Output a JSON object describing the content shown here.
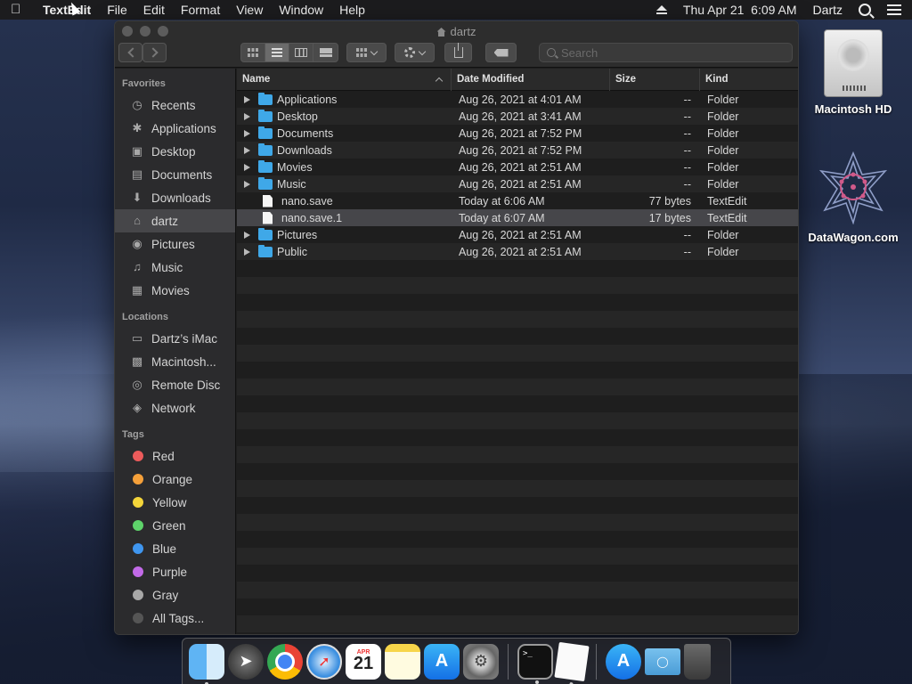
{
  "menubar": {
    "app_name": "TextEdit",
    "items": [
      "File",
      "Edit",
      "Format",
      "View",
      "Window",
      "Help"
    ],
    "datetime": "Thu Apr 21  6:09 AM",
    "user": "Dartz"
  },
  "window": {
    "title": "dartz",
    "search_placeholder": "Search"
  },
  "sidebar": {
    "favorites_heading": "Favorites",
    "favorites": [
      {
        "label": "Recents",
        "icon": "clock-icon"
      },
      {
        "label": "Applications",
        "icon": "applications-icon"
      },
      {
        "label": "Desktop",
        "icon": "desktop-icon"
      },
      {
        "label": "Documents",
        "icon": "documents-icon"
      },
      {
        "label": "Downloads",
        "icon": "downloads-icon"
      },
      {
        "label": "dartz",
        "icon": "home-icon"
      },
      {
        "label": "Pictures",
        "icon": "camera-icon"
      },
      {
        "label": "Music",
        "icon": "music-note-icon"
      },
      {
        "label": "Movies",
        "icon": "film-icon"
      }
    ],
    "locations_heading": "Locations",
    "locations": [
      {
        "label": "Dartz’s iMac",
        "icon": "imac-icon"
      },
      {
        "label": "Macintosh...",
        "icon": "hard-drive-icon"
      },
      {
        "label": "Remote Disc",
        "icon": "disc-icon"
      },
      {
        "label": "Network",
        "icon": "globe-icon"
      }
    ],
    "tags_heading": "Tags",
    "tags": [
      {
        "label": "Red",
        "color": "#ec5b5b"
      },
      {
        "label": "Orange",
        "color": "#f5a03a"
      },
      {
        "label": "Yellow",
        "color": "#f4d53a"
      },
      {
        "label": "Green",
        "color": "#5ed36a"
      },
      {
        "label": "Blue",
        "color": "#3f96ef"
      },
      {
        "label": "Purple",
        "color": "#c26ae8"
      },
      {
        "label": "Gray",
        "color": "#a8a8a8"
      },
      {
        "label": "All Tags...",
        "color": "#555555"
      }
    ]
  },
  "columns": {
    "name": "Name",
    "date": "Date Modified",
    "size": "Size",
    "kind": "Kind"
  },
  "files": [
    {
      "name": "Applications",
      "date": "Aug 26, 2021 at 4:01 AM",
      "size": "--",
      "kind": "Folder",
      "type": "folder"
    },
    {
      "name": "Desktop",
      "date": "Aug 26, 2021 at 3:41 AM",
      "size": "--",
      "kind": "Folder",
      "type": "folder"
    },
    {
      "name": "Documents",
      "date": "Aug 26, 2021 at 7:52 PM",
      "size": "--",
      "kind": "Folder",
      "type": "folder"
    },
    {
      "name": "Downloads",
      "date": "Aug 26, 2021 at 7:52 PM",
      "size": "--",
      "kind": "Folder",
      "type": "folder"
    },
    {
      "name": "Movies",
      "date": "Aug 26, 2021 at 2:51 AM",
      "size": "--",
      "kind": "Folder",
      "type": "folder"
    },
    {
      "name": "Music",
      "date": "Aug 26, 2021 at 2:51 AM",
      "size": "--",
      "kind": "Folder",
      "type": "folder"
    },
    {
      "name": "nano.save",
      "date": "Today at 6:06 AM",
      "size": "77 bytes",
      "kind": "TextEdit",
      "type": "file"
    },
    {
      "name": "nano.save.1",
      "date": "Today at 6:07 AM",
      "size": "17 bytes",
      "kind": "TextEdit",
      "type": "file",
      "selected": true
    },
    {
      "name": "Pictures",
      "date": "Aug 26, 2021 at 2:51 AM",
      "size": "--",
      "kind": "Folder",
      "type": "folder"
    },
    {
      "name": "Public",
      "date": "Aug 26, 2021 at 2:51 AM",
      "size": "--",
      "kind": "Folder",
      "type": "folder"
    }
  ],
  "desktop": {
    "items": [
      {
        "label": "Macintosh HD",
        "icon": "hard-drive-icon"
      },
      {
        "label": "DataWagon.com",
        "icon": "star-logo-icon"
      }
    ]
  },
  "dock": {
    "apps": [
      {
        "name": "finder",
        "icon": "finder-icon",
        "running": true
      },
      {
        "name": "launchpad",
        "icon": "rocket-icon",
        "running": false
      },
      {
        "name": "chrome",
        "icon": "chrome-icon",
        "running": false
      },
      {
        "name": "safari",
        "icon": "compass-icon",
        "running": false
      },
      {
        "name": "calendar",
        "icon": "calendar-icon",
        "running": false,
        "month": "APR",
        "day": "21"
      },
      {
        "name": "notes",
        "icon": "notes-icon",
        "running": false
      },
      {
        "name": "app-store",
        "icon": "app-store-icon",
        "running": false
      },
      {
        "name": "system-preferences",
        "icon": "gear-icon",
        "running": false
      },
      {
        "name": "terminal",
        "icon": "terminal-icon",
        "running": true,
        "prompt": ">_"
      },
      {
        "name": "textedit",
        "icon": "textedit-icon",
        "running": true
      },
      {
        "name": "app-store-2",
        "icon": "app-store-icon",
        "running": false
      },
      {
        "name": "downloads-folder",
        "icon": "folder-icon",
        "running": false
      },
      {
        "name": "trash",
        "icon": "trash-icon",
        "running": false
      }
    ]
  }
}
